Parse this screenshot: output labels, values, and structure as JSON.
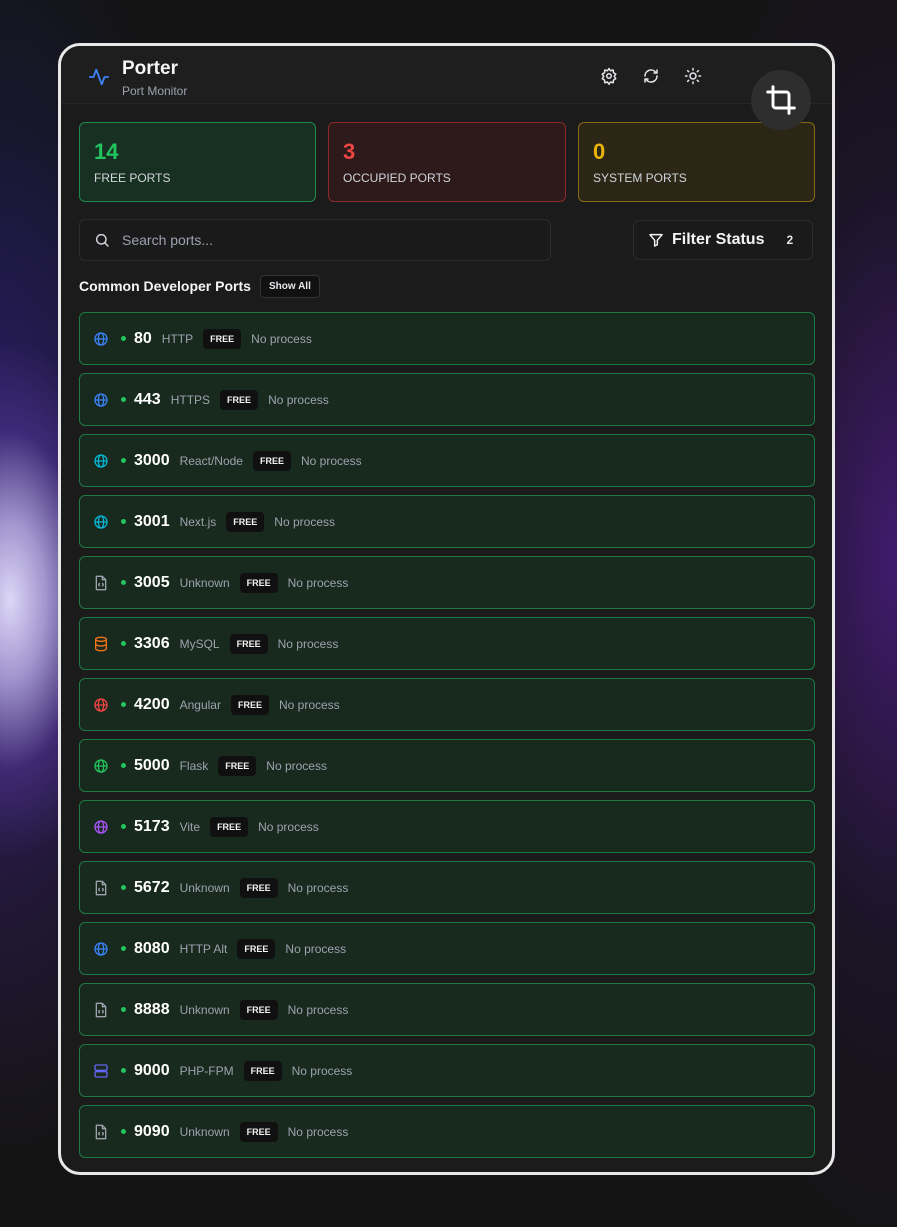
{
  "app": {
    "title": "Porter",
    "subtitle": "Port Monitor"
  },
  "header_icons": [
    "settings-icon",
    "refresh-icon",
    "theme-toggle-icon"
  ],
  "overlay": {
    "icon": "crop-icon"
  },
  "stats": {
    "free": {
      "value": "14",
      "label": "FREE PORTS",
      "color": "#22c55e"
    },
    "occupied": {
      "value": "3",
      "label": "OCCUPIED PORTS",
      "color": "#ef4444"
    },
    "system": {
      "value": "0",
      "label": "SYSTEM PORTS",
      "color": "#eab308"
    }
  },
  "search": {
    "placeholder": "Search ports..."
  },
  "filter": {
    "label": "Filter Status",
    "count": "2"
  },
  "section": {
    "title": "Common Developer Ports",
    "show_all": "Show All"
  },
  "ports": [
    {
      "port": "80",
      "name": "HTTP",
      "status": "FREE",
      "process": "No process",
      "icon": "globe-icon",
      "icon_color": "#3b82f6"
    },
    {
      "port": "443",
      "name": "HTTPS",
      "status": "FREE",
      "process": "No process",
      "icon": "globe-icon",
      "icon_color": "#3b82f6"
    },
    {
      "port": "3000",
      "name": "React/Node",
      "status": "FREE",
      "process": "No process",
      "icon": "globe-icon",
      "icon_color": "#06b6d4"
    },
    {
      "port": "3001",
      "name": "Next.js",
      "status": "FREE",
      "process": "No process",
      "icon": "globe-icon",
      "icon_color": "#06b6d4"
    },
    {
      "port": "3005",
      "name": "Unknown",
      "status": "FREE",
      "process": "No process",
      "icon": "file-code-icon",
      "icon_color": "#9ca3af"
    },
    {
      "port": "3306",
      "name": "MySQL",
      "status": "FREE",
      "process": "No process",
      "icon": "database-icon",
      "icon_color": "#f97316"
    },
    {
      "port": "4200",
      "name": "Angular",
      "status": "FREE",
      "process": "No process",
      "icon": "globe-icon",
      "icon_color": "#ef4444"
    },
    {
      "port": "5000",
      "name": "Flask",
      "status": "FREE",
      "process": "No process",
      "icon": "globe-icon",
      "icon_color": "#22c55e"
    },
    {
      "port": "5173",
      "name": "Vite",
      "status": "FREE",
      "process": "No process",
      "icon": "globe-icon",
      "icon_color": "#a855f7"
    },
    {
      "port": "5672",
      "name": "Unknown",
      "status": "FREE",
      "process": "No process",
      "icon": "file-code-icon",
      "icon_color": "#9ca3af"
    },
    {
      "port": "8080",
      "name": "HTTP Alt",
      "status": "FREE",
      "process": "No process",
      "icon": "globe-icon",
      "icon_color": "#3b82f6"
    },
    {
      "port": "8888",
      "name": "Unknown",
      "status": "FREE",
      "process": "No process",
      "icon": "file-code-icon",
      "icon_color": "#9ca3af"
    },
    {
      "port": "9000",
      "name": "PHP-FPM",
      "status": "FREE",
      "process": "No process",
      "icon": "server-icon",
      "icon_color": "#6366f1"
    },
    {
      "port": "9090",
      "name": "Unknown",
      "status": "FREE",
      "process": "No process",
      "icon": "file-code-icon",
      "icon_color": "#9ca3af"
    }
  ]
}
